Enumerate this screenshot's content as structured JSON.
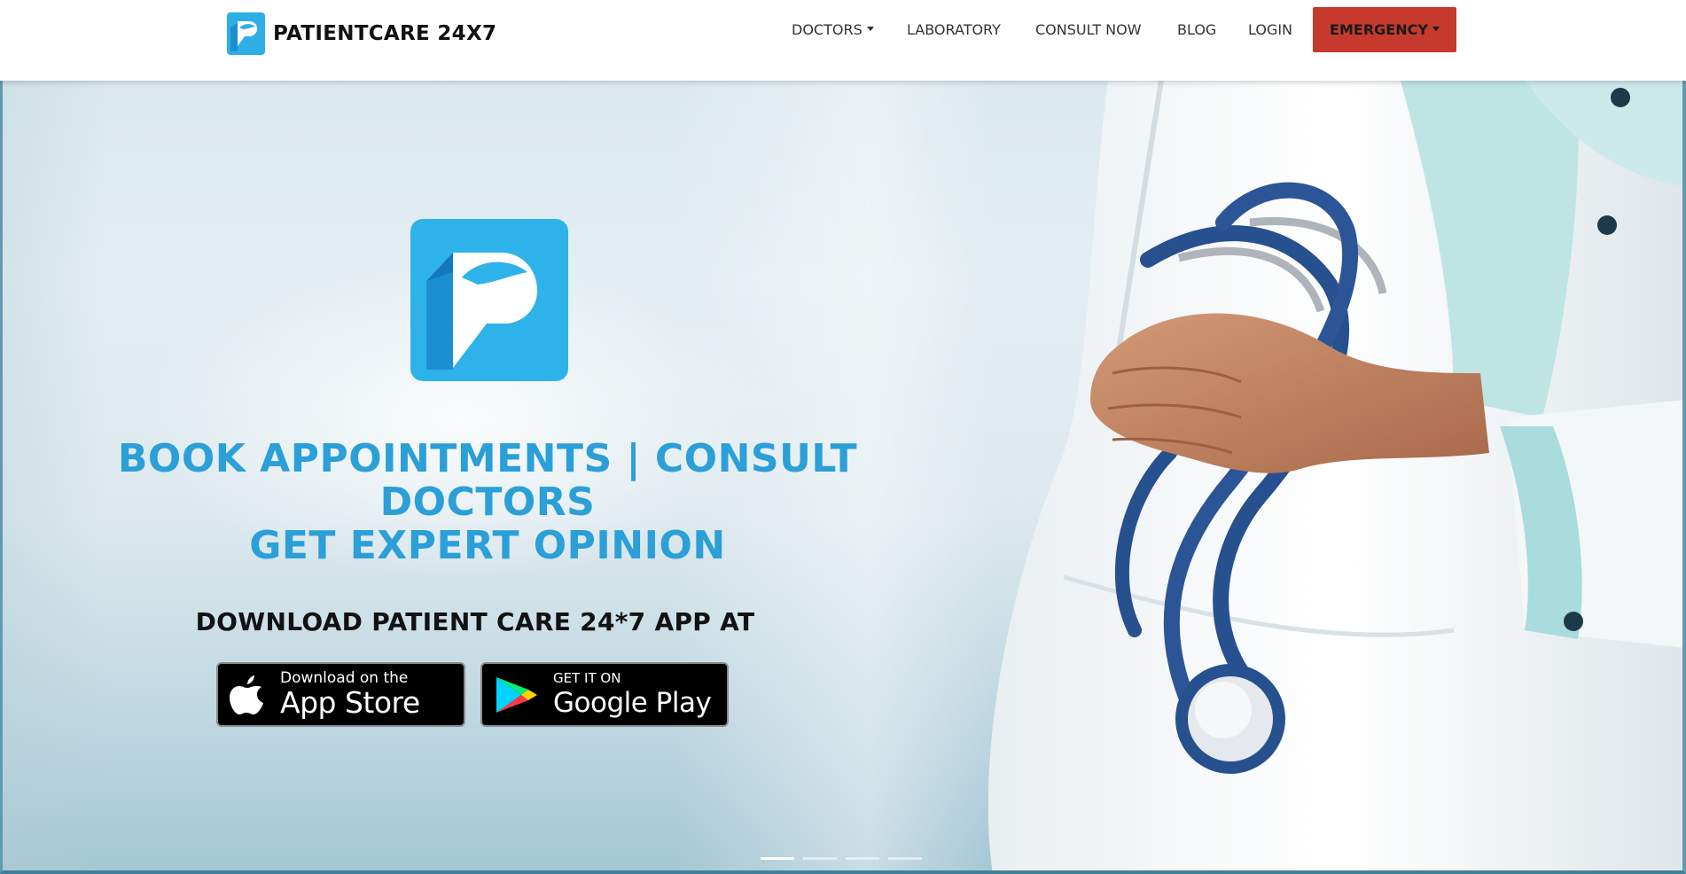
{
  "navbar": {
    "brand": "PATIENTCARE 24X7",
    "items": [
      {
        "label": "DOCTORS",
        "has_dropdown": true
      },
      {
        "label": "LABORATORY",
        "has_dropdown": false
      },
      {
        "label": "CONSULT NOW",
        "has_dropdown": false
      },
      {
        "label": "BLOG",
        "has_dropdown": false
      },
      {
        "label": "LOGIN",
        "has_dropdown": false
      }
    ],
    "emergency_label": "EMERGENCY",
    "emergency_color": "#c53a2d"
  },
  "hero": {
    "tagline_line1": "BOOK APPOINTMENTS | CONSULT DOCTORS",
    "tagline_line2": "GET EXPERT OPINION",
    "tagline_color": "#2b9fd7",
    "download_heading": "DOWNLOAD PATIENT CARE 24*7 APP AT",
    "app_store": {
      "small": "Download on the",
      "big": "App Store",
      "icon": "apple-icon"
    },
    "google_play": {
      "small": "GET IT ON",
      "big": "Google Play",
      "icon": "google-play-icon"
    },
    "carousel": {
      "slides": 4,
      "active": 1
    }
  },
  "colors": {
    "brand_blue": "#2eaee6",
    "brand_blue_dark": "#1a8fd0"
  }
}
